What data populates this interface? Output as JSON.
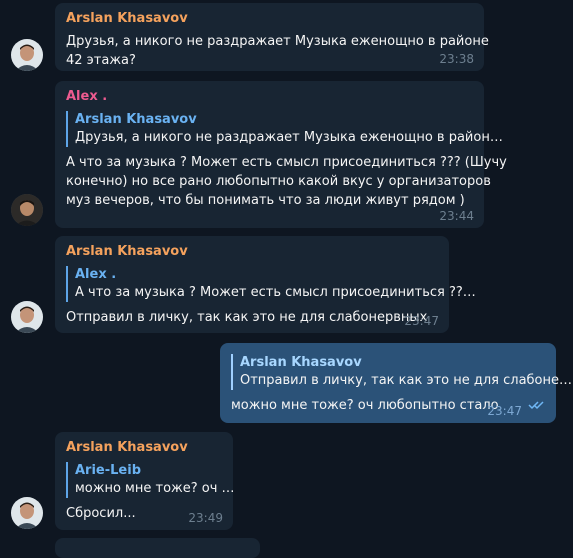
{
  "colors": {
    "background": "#0e1621",
    "incoming_bubble": "#182533",
    "outgoing_bubble": "#2b5278",
    "arslan_name": "#f5a25d",
    "alex_name": "#ee5b90",
    "reply_accent": "#5ea5e8"
  },
  "messages": [
    {
      "sender": "Arslan Khasavov",
      "lines": [
        "Друзья, а никого не раздражает Музыка еженощно в районе",
        "42 этажа?"
      ],
      "time": "23:38"
    },
    {
      "sender": "Alex .",
      "reply_name": "Arslan Khasavov",
      "reply_text": "Друзья, а никого не раздражает Музыка еженощно в район…",
      "lines": [
        "А что за музыка ? Может есть смысл присоединиться ??? (Шучу",
        "конечно) но все рано любопытно какой вкус у организаторов",
        "муз вечеров, что бы понимать что за люди живут рядом )"
      ],
      "time": "23:44"
    },
    {
      "sender": "Arslan Khasavov",
      "reply_name": "Alex .",
      "reply_text": "А что за музыка ? Может есть смысл присоединиться ??…",
      "lines": [
        "Отправил в личку, так как это не для слабонервных"
      ],
      "time": "23:47"
    },
    {
      "reply_name": "Arslan Khasavov",
      "reply_text": "Отправил в личку, так как это не для слабоне…",
      "lines": [
        "можно мне тоже? оч любопытно стало"
      ],
      "time": "23:47",
      "read_icon": "double-check-icon"
    },
    {
      "sender": "Arslan Khasavov",
      "reply_name": "Arie-Leib",
      "reply_text": "можно мне тоже? оч …",
      "lines": [
        "Сбросил..."
      ],
      "time": "23:49"
    }
  ]
}
